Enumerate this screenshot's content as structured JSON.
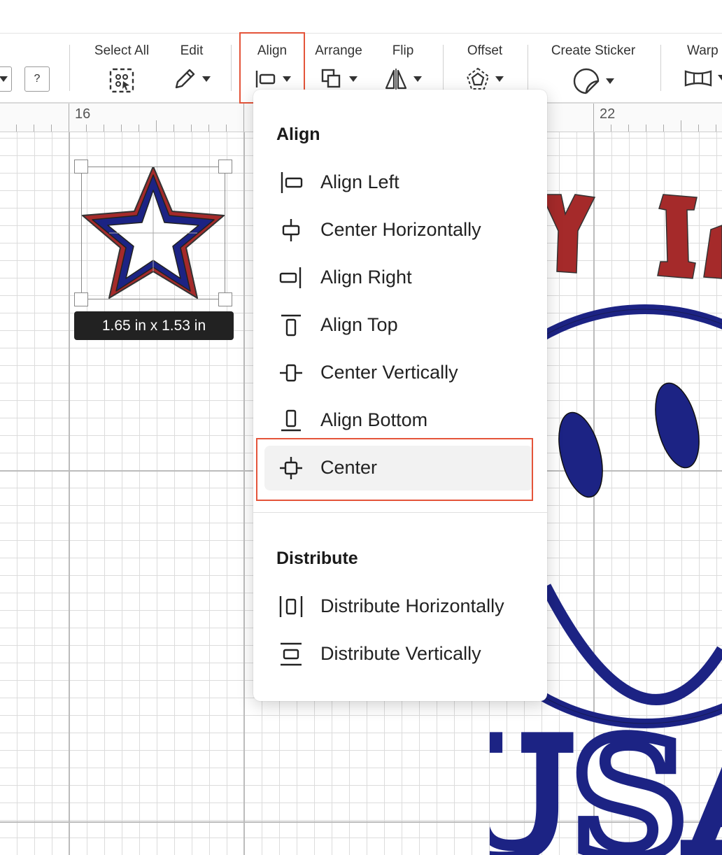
{
  "toolbar": {
    "help_label": "?",
    "select_all_label": "Select All",
    "edit_label": "Edit",
    "align_label": "Align",
    "arrange_label": "Arrange",
    "flip_label": "Flip",
    "offset_label": "Offset",
    "create_sticker_label": "Create Sticker",
    "warp_label": "Warp"
  },
  "ruler": {
    "labels": [
      "16",
      "22"
    ]
  },
  "selection": {
    "size_label": "1.65  in x 1.53  in"
  },
  "align_menu": {
    "align_heading": "Align",
    "items": [
      {
        "label": "Align Left",
        "icon": "align-left-icon"
      },
      {
        "label": "Center Horizontally",
        "icon": "center-horizontally-icon"
      },
      {
        "label": "Align Right",
        "icon": "align-right-icon"
      },
      {
        "label": "Align Top",
        "icon": "align-top-icon"
      },
      {
        "label": "Center Vertically",
        "icon": "center-vertically-icon"
      },
      {
        "label": "Align Bottom",
        "icon": "align-bottom-icon"
      },
      {
        "label": "Center",
        "icon": "center-icon",
        "highlighted": true
      }
    ],
    "distribute_heading": "Distribute",
    "distribute_items": [
      {
        "label": "Distribute Horizontally",
        "icon": "distribute-horizontally-icon"
      },
      {
        "label": "Distribute Vertically",
        "icon": "distribute-vertically-icon"
      }
    ]
  },
  "canvas_art": {
    "usa_text": "USA"
  },
  "colors": {
    "highlight": "#e4543a",
    "navy": "#1c2384",
    "red": "#a52a2a"
  }
}
